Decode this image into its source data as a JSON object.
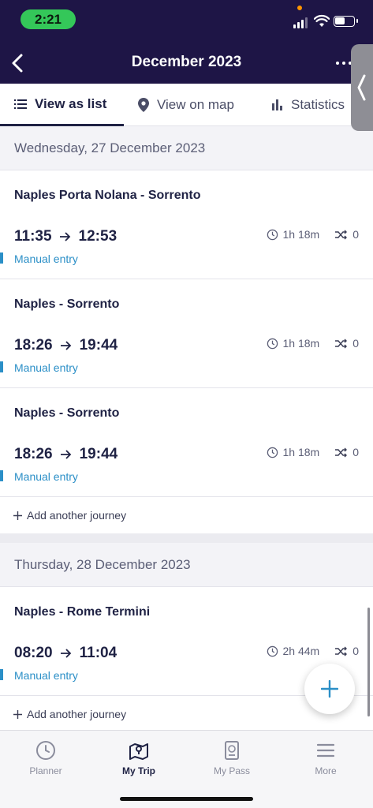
{
  "status_bar": {
    "time": "2:21"
  },
  "header": {
    "title": "December 2023"
  },
  "tabs": [
    {
      "label": "View as list",
      "icon": "list-icon",
      "active": true
    },
    {
      "label": "View on map",
      "icon": "map-pin-icon",
      "active": false
    },
    {
      "label": "Statistics",
      "icon": "bar-chart-icon",
      "active": false
    }
  ],
  "days": [
    {
      "date": "Wednesday, 27 December 2023",
      "journeys": [
        {
          "route": "Naples Porta Nolana - Sorrento",
          "depart": "11:35",
          "arrive": "12:53",
          "duration": "1h 18m",
          "changes": "0",
          "entry": "Manual entry"
        },
        {
          "route": "Naples - Sorrento",
          "depart": "18:26",
          "arrive": "19:44",
          "duration": "1h 18m",
          "changes": "0",
          "entry": "Manual entry"
        },
        {
          "route": "Naples - Sorrento",
          "depart": "18:26",
          "arrive": "19:44",
          "duration": "1h 18m",
          "changes": "0",
          "entry": "Manual entry"
        }
      ],
      "add_label": "Add another journey"
    },
    {
      "date": "Thursday, 28 December 2023",
      "journeys": [
        {
          "route": "Naples - Rome Termini",
          "depart": "08:20",
          "arrive": "11:04",
          "duration": "2h 44m",
          "changes": "0",
          "entry": "Manual entry"
        }
      ],
      "add_label": "Add another journey"
    }
  ],
  "bottom_nav": [
    {
      "label": "Planner",
      "icon": "clock-icon",
      "active": false
    },
    {
      "label": "My Trip",
      "icon": "map-icon",
      "active": true
    },
    {
      "label": "My Pass",
      "icon": "passport-icon",
      "active": false
    },
    {
      "label": "More",
      "icon": "menu-icon",
      "active": false
    }
  ],
  "colors": {
    "header_bg": "#1e1546",
    "accent": "#2b8fc7",
    "text_primary": "#1f2244",
    "status_pill": "#34c759"
  }
}
